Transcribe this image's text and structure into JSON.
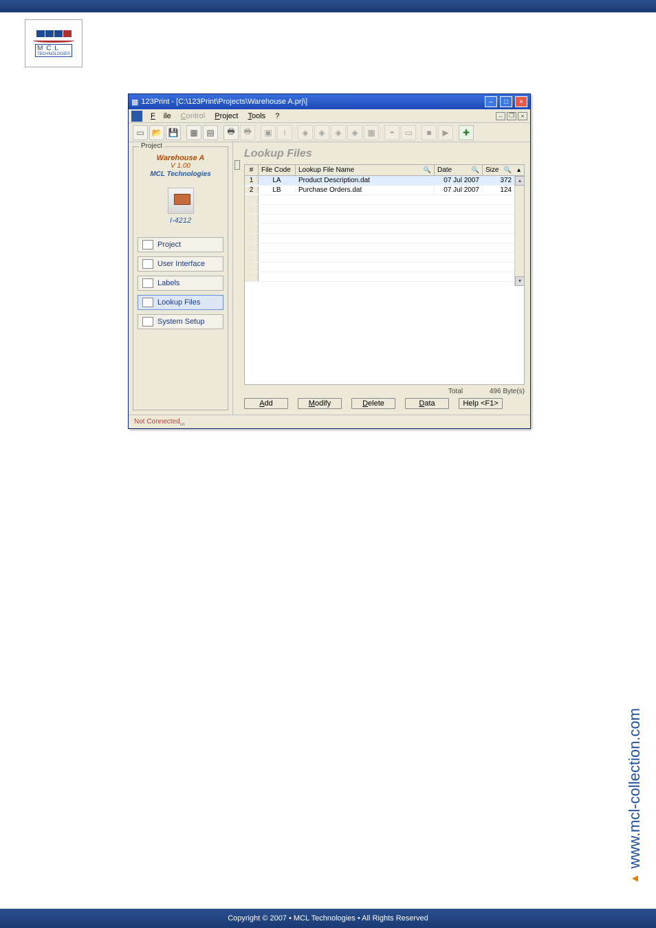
{
  "document": {
    "logo_letters": "M C L",
    "logo_small": "TECHNOLOGIES",
    "side_url": "www.mcl-collection.com",
    "copyright": "Copyright © 2007 • MCL Technologies • All Rights Reserved"
  },
  "window": {
    "title": "123Print - [C:\\123Print\\Projects\\Warehouse A.prj\\]"
  },
  "menu": {
    "file": "File",
    "control": "Control",
    "project": "Project",
    "tools": "Tools",
    "help": "?"
  },
  "project": {
    "group_label": "Project",
    "name": "Warehouse A",
    "version": "V 1.00",
    "vendor": "MCL Technologies",
    "printer_model": "I-4212"
  },
  "nav": {
    "project": "Project",
    "ui": "User Interface",
    "labels": "Labels",
    "lookup": "Lookup Files",
    "system": "System Setup"
  },
  "content": {
    "heading": "Lookup Files",
    "columns": {
      "num": "#",
      "code": "File Code",
      "name": "Lookup File Name",
      "date": "Date",
      "size": "Size"
    },
    "rows": [
      {
        "num": "1",
        "code": "LA",
        "name": "Product Description.dat",
        "date": "07 Jul 2007",
        "size": "372"
      },
      {
        "num": "2",
        "code": "LB",
        "name": "Purchase Orders.dat",
        "date": "07 Jul 2007",
        "size": "124"
      }
    ],
    "total_label": "Total",
    "total_value": "496 Byte(s)"
  },
  "buttons": {
    "add": "Add",
    "modify": "Modify",
    "delete": "Delete",
    "data": "Data",
    "help": "Help <F1>"
  },
  "status": {
    "left": "Not Connected",
    "right": "∞"
  }
}
